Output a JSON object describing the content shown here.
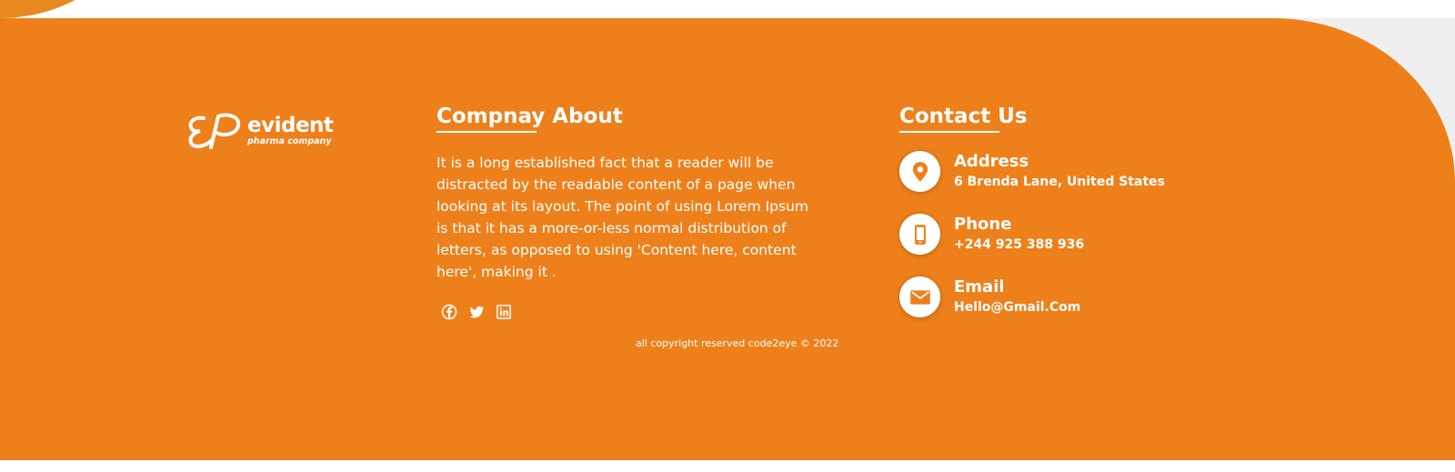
{
  "brand": {
    "name": "evident",
    "tagline": "pharma company",
    "accent_color": "#ee801b"
  },
  "about": {
    "title": "Compnay About",
    "text": "It is a long established fact that a reader will be distracted by the readable content of a page when looking at its layout. The point of using Lorem Ipsum is that it has a more-or-less normal distribution of letters, as opposed to using 'Content here, content here', making it .",
    "socials": [
      {
        "name": "facebook",
        "icon": "facebook-icon"
      },
      {
        "name": "twitter",
        "icon": "twitter-icon"
      },
      {
        "name": "linkedin",
        "icon": "linkedin-icon"
      }
    ]
  },
  "contact": {
    "title": "Contact Us",
    "items": [
      {
        "label": "Address",
        "value": "6 Brenda Lane, United States",
        "icon": "map-pin-icon"
      },
      {
        "label": "Phone",
        "value": "+244 925 388 936",
        "icon": "phone-icon"
      },
      {
        "label": "Email",
        "value": "Hello@Gmail.Com",
        "icon": "envelope-icon"
      }
    ]
  },
  "footer": {
    "copyright": "all copyright reserved code2eye © 2022"
  }
}
